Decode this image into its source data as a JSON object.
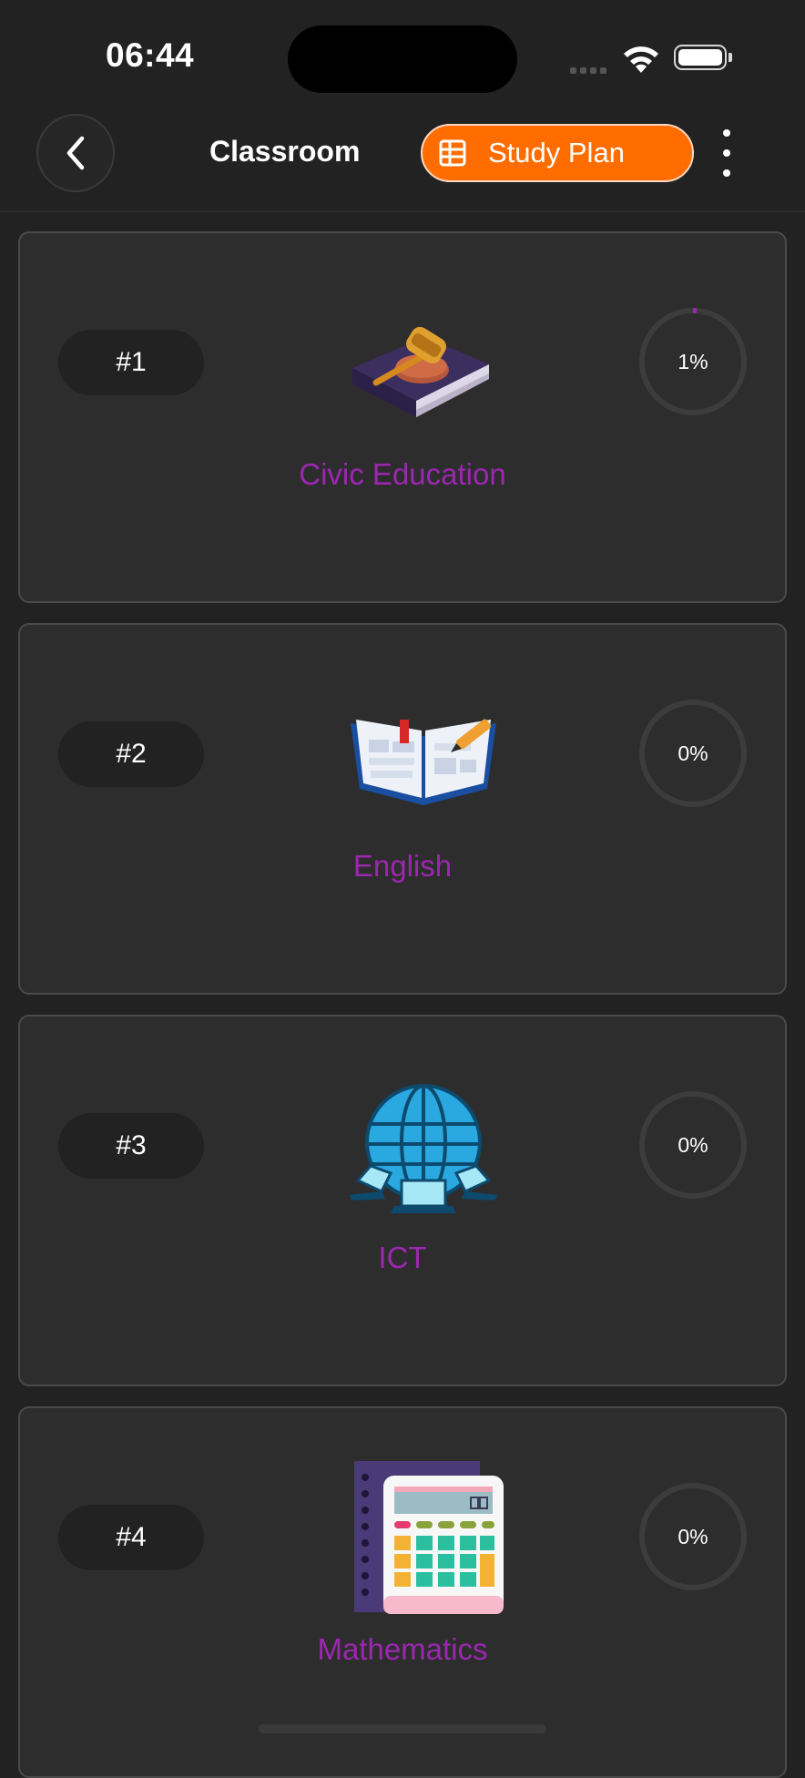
{
  "status_bar": {
    "time": "06:44"
  },
  "header": {
    "title": "Classroom",
    "study_plan_label": "Study Plan",
    "accent": "#ff6d00"
  },
  "subjects": [
    {
      "rank": "#1",
      "name": "Civic Education",
      "progress_text": "1%",
      "progress": 1,
      "icon": "gavel-book-icon"
    },
    {
      "rank": "#2",
      "name": "English",
      "progress_text": "0%",
      "progress": 0,
      "icon": "open-book-icon"
    },
    {
      "rank": "#3",
      "name": "ICT",
      "progress_text": "0%",
      "progress": 0,
      "icon": "globe-network-icon"
    },
    {
      "rank": "#4",
      "name": "Mathematics",
      "progress_text": "0%",
      "progress": 0,
      "icon": "calculator-icon"
    }
  ],
  "colors": {
    "subject_name": "#9c27b0",
    "progress_track": "#3c3c3c",
    "progress_fill": "#9c27b0"
  }
}
